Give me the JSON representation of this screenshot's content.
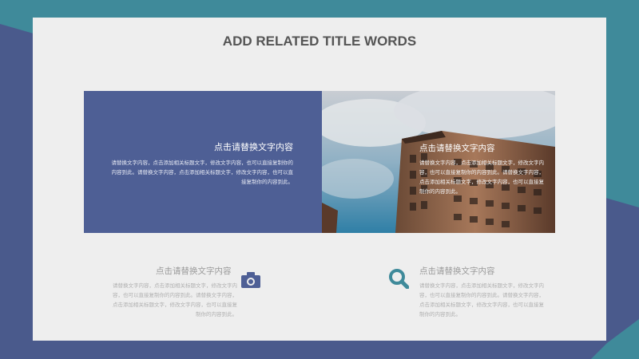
{
  "slide": {
    "title": "ADD RELATED TITLE WORDS"
  },
  "panel": {
    "heading": "点击请替换文字内容",
    "body": "请替换文字内容，点击添加相关标题文字，修改文字内容，也可以直接复制你的内容到此。请替换文字内容，点击添加相关标题文字，修改文字内容，也可以直接复制你的内容到此。"
  },
  "photo": {
    "heading": "点击请替换文字内容",
    "body": "请替换文字内容，点击添加相关标题文字，修改文字内容，也可以直接复制你的内容到此。请替换文字内容，点击添加相关标题文字，修改文字内容，也可以直接复制你的内容到此。"
  },
  "features": [
    {
      "heading": "点击请替换文字内容",
      "body": "请替换文字内容，点击添加相关标题文字，修改文字内容，也可以直接复制你的内容到此。请替换文字内容，点击添加相关标题文字，修改文字内容，也可以直接复制你的内容到此。",
      "icon": "camera-icon"
    },
    {
      "heading": "点击请替换文字内容",
      "body": "请替换文字内容，点击添加相关标题文字，修改文字内容，也可以直接复制你的内容到此。请替换文字内容，点击添加相关标题文字，修改文字内容，也可以直接复制你的内容到此。",
      "icon": "search-icon"
    }
  ],
  "colors": {
    "navy": "#4e5f95",
    "teal": "#3f8a9a",
    "slide_bg": "#eeeeee",
    "title": "#555555"
  }
}
